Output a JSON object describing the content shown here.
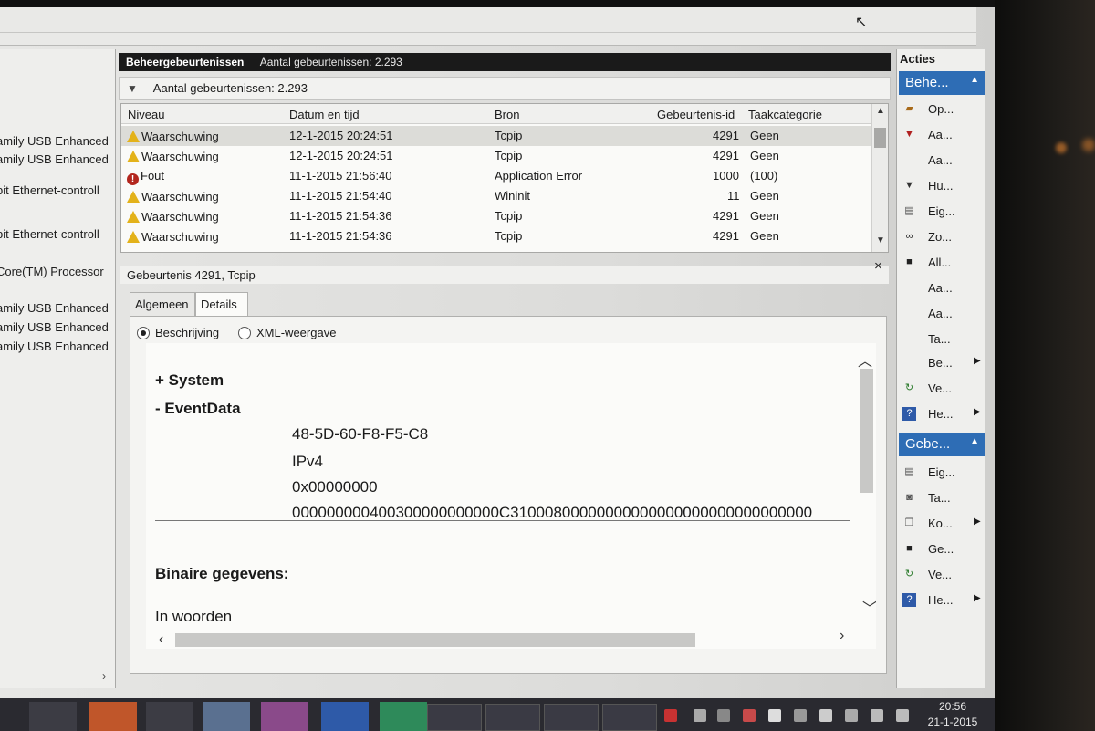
{
  "colors": {
    "accent_blue": "#2e6db5",
    "warning": "#e3b21a",
    "error": "#b3261e",
    "header_bg": "#1a1a1a"
  },
  "left_pane": {
    "items": [
      "amily USB Enhanced",
      "amily USB Enhanced",
      "bit Ethernet-controll",
      "bit Ethernet-controll",
      "Core(TM) Processor",
      "amily USB Enhanced",
      "amily USB Enhanced",
      "amily USB Enhanced"
    ],
    "scroll_icon": "chevron-right-icon"
  },
  "header": {
    "title": "Beheergebeurtenissen",
    "count": "Aantal gebeurtenissen: 2.293"
  },
  "filter": {
    "icon": "filter-icon",
    "text": "Aantal gebeurtenissen: 2.293"
  },
  "events": {
    "columns": [
      "Niveau",
      "Datum en tijd",
      "Bron",
      "Gebeurtenis-id",
      "Taakcategorie"
    ],
    "rows": [
      {
        "level": "Waarschuwing",
        "icon": "warning-icon",
        "datetime": "12-1-2015 20:24:51",
        "source": "Tcpip",
        "id": "4291",
        "category": "Geen"
      },
      {
        "level": "Waarschuwing",
        "icon": "warning-icon",
        "datetime": "12-1-2015 20:24:51",
        "source": "Tcpip",
        "id": "4291",
        "category": "Geen"
      },
      {
        "level": "Fout",
        "icon": "error-icon",
        "datetime": "11-1-2015 21:56:40",
        "source": "Application Error",
        "id": "1000",
        "category": "(100)"
      },
      {
        "level": "Waarschuwing",
        "icon": "warning-icon",
        "datetime": "11-1-2015 21:54:40",
        "source": "Wininit",
        "id": "11",
        "category": "Geen"
      },
      {
        "level": "Waarschuwing",
        "icon": "warning-icon",
        "datetime": "11-1-2015 21:54:36",
        "source": "Tcpip",
        "id": "4291",
        "category": "Geen"
      },
      {
        "level": "Waarschuwing",
        "icon": "warning-icon",
        "datetime": "11-1-2015 21:54:36",
        "source": "Tcpip",
        "id": "4291",
        "category": "Geen"
      }
    ]
  },
  "detail": {
    "title": "Gebeurtenis 4291, Tcpip",
    "close": "×",
    "tabs": [
      "Algemeen",
      "Details"
    ],
    "active_tab": "Details",
    "radio_description": "Beschrijving",
    "radio_xml": "XML-weergave",
    "selected_view": "Beschrijving",
    "system_label": "+ System",
    "eventdata_label": "- EventData",
    "values": [
      "48-5D-60-F8-F5-C8",
      "IPv4",
      "0x00000000",
      "000000000400300000000000C31000800000000000000000000000000000"
    ],
    "binary_label": "Binaire gegevens:",
    "words_label": "In woorden"
  },
  "actions": {
    "title": "Acties",
    "group1": "Behe...",
    "group1_items": [
      {
        "label": "Op...",
        "icon": "open-folder-icon"
      },
      {
        "label": "Aa...",
        "icon": "filter-icon"
      },
      {
        "label": "Aa...",
        "icon": ""
      },
      {
        "label": "Hu...",
        "icon": "filter-icon"
      },
      {
        "label": "Eig...",
        "icon": "properties-icon"
      },
      {
        "label": "Zo...",
        "icon": "binoculars-icon"
      },
      {
        "label": "All...",
        "icon": "save-icon"
      },
      {
        "label": "Aa...",
        "icon": ""
      },
      {
        "label": "Aa...",
        "icon": ""
      },
      {
        "label": "Ta...",
        "icon": ""
      },
      {
        "label": "Be...",
        "icon": "",
        "submenu": "▶"
      },
      {
        "label": "Ve...",
        "icon": "refresh-icon"
      },
      {
        "label": "He...",
        "icon": "help-icon",
        "submenu": "▶"
      }
    ],
    "group2": "Gebe...",
    "group2_items": [
      {
        "label": "Eig...",
        "icon": "properties-icon"
      },
      {
        "label": "Ta...",
        "icon": "task-icon"
      },
      {
        "label": "Ko...",
        "icon": "copy-icon",
        "submenu": "▶"
      },
      {
        "label": "Ge...",
        "icon": "save-icon"
      },
      {
        "label": "Ve...",
        "icon": "refresh-icon"
      },
      {
        "label": "He...",
        "icon": "help-icon",
        "submenu": "▶"
      }
    ]
  },
  "taskbar": {
    "time": "20:56",
    "date": "21-1-2015"
  }
}
